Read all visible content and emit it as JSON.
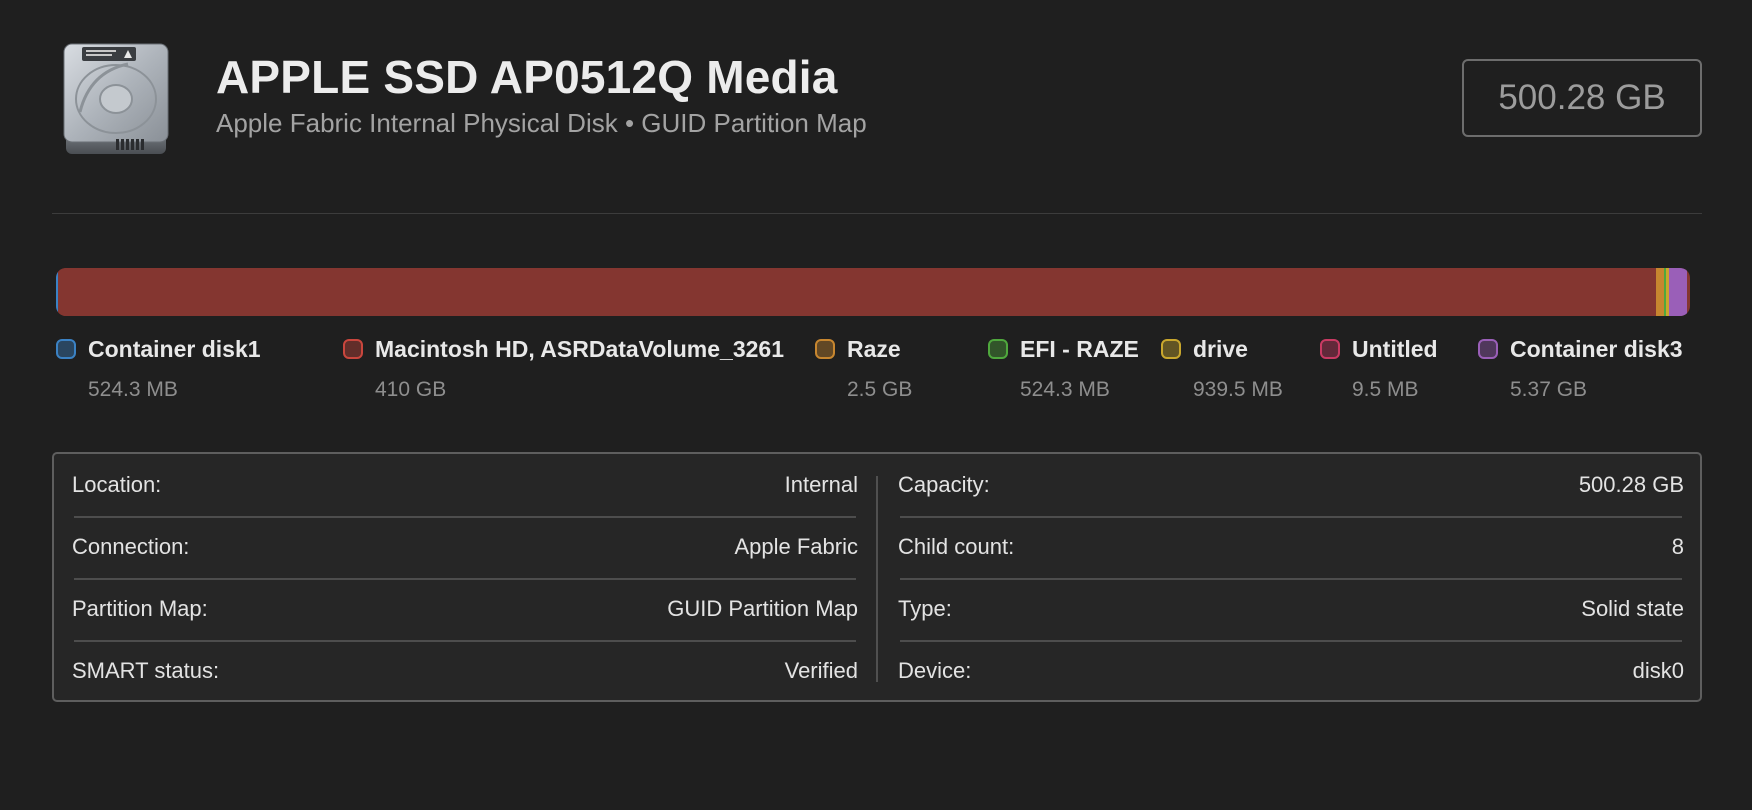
{
  "disk": {
    "title": "APPLE SSD AP0512Q Media",
    "subtitle": "Apple Fabric Internal Physical Disk • GUID Partition Map",
    "size": "500.28 GB"
  },
  "volumes": [
    {
      "name": "Container disk1",
      "size": "524.3 MB",
      "color": "#3b82c4",
      "fill": 0.0011
    },
    {
      "name": "Macintosh HD, ASRDataVolume_3261",
      "size": "410 GB",
      "color": "#c9463d",
      "fill": 0.978
    },
    {
      "name": "Raze",
      "size": "2.5 GB",
      "color": "#c7862f",
      "fill": 0.005
    },
    {
      "name": "EFI - RAZE",
      "size": "524.3 MB",
      "color": "#4fa83d",
      "fill": 0.0011
    },
    {
      "name": "drive",
      "size": "939.5 MB",
      "color": "#c9a72d",
      "fill": 0.002
    },
    {
      "name": "Untitled",
      "size": "9.5 MB",
      "color": "#c93a63",
      "fill": 0.0002
    },
    {
      "name": "Container disk3",
      "size": "5.37 GB",
      "color": "#9a5fb8",
      "fill": 0.0107
    }
  ],
  "info": {
    "left": [
      {
        "label": "Location:",
        "value": "Internal"
      },
      {
        "label": "Connection:",
        "value": "Apple Fabric"
      },
      {
        "label": "Partition Map:",
        "value": "GUID Partition Map"
      },
      {
        "label": "SMART status:",
        "value": "Verified"
      }
    ],
    "right": [
      {
        "label": "Capacity:",
        "value": "500.28 GB"
      },
      {
        "label": "Child count:",
        "value": "8"
      },
      {
        "label": "Type:",
        "value": "Solid state"
      },
      {
        "label": "Device:",
        "value": "disk0"
      }
    ]
  }
}
